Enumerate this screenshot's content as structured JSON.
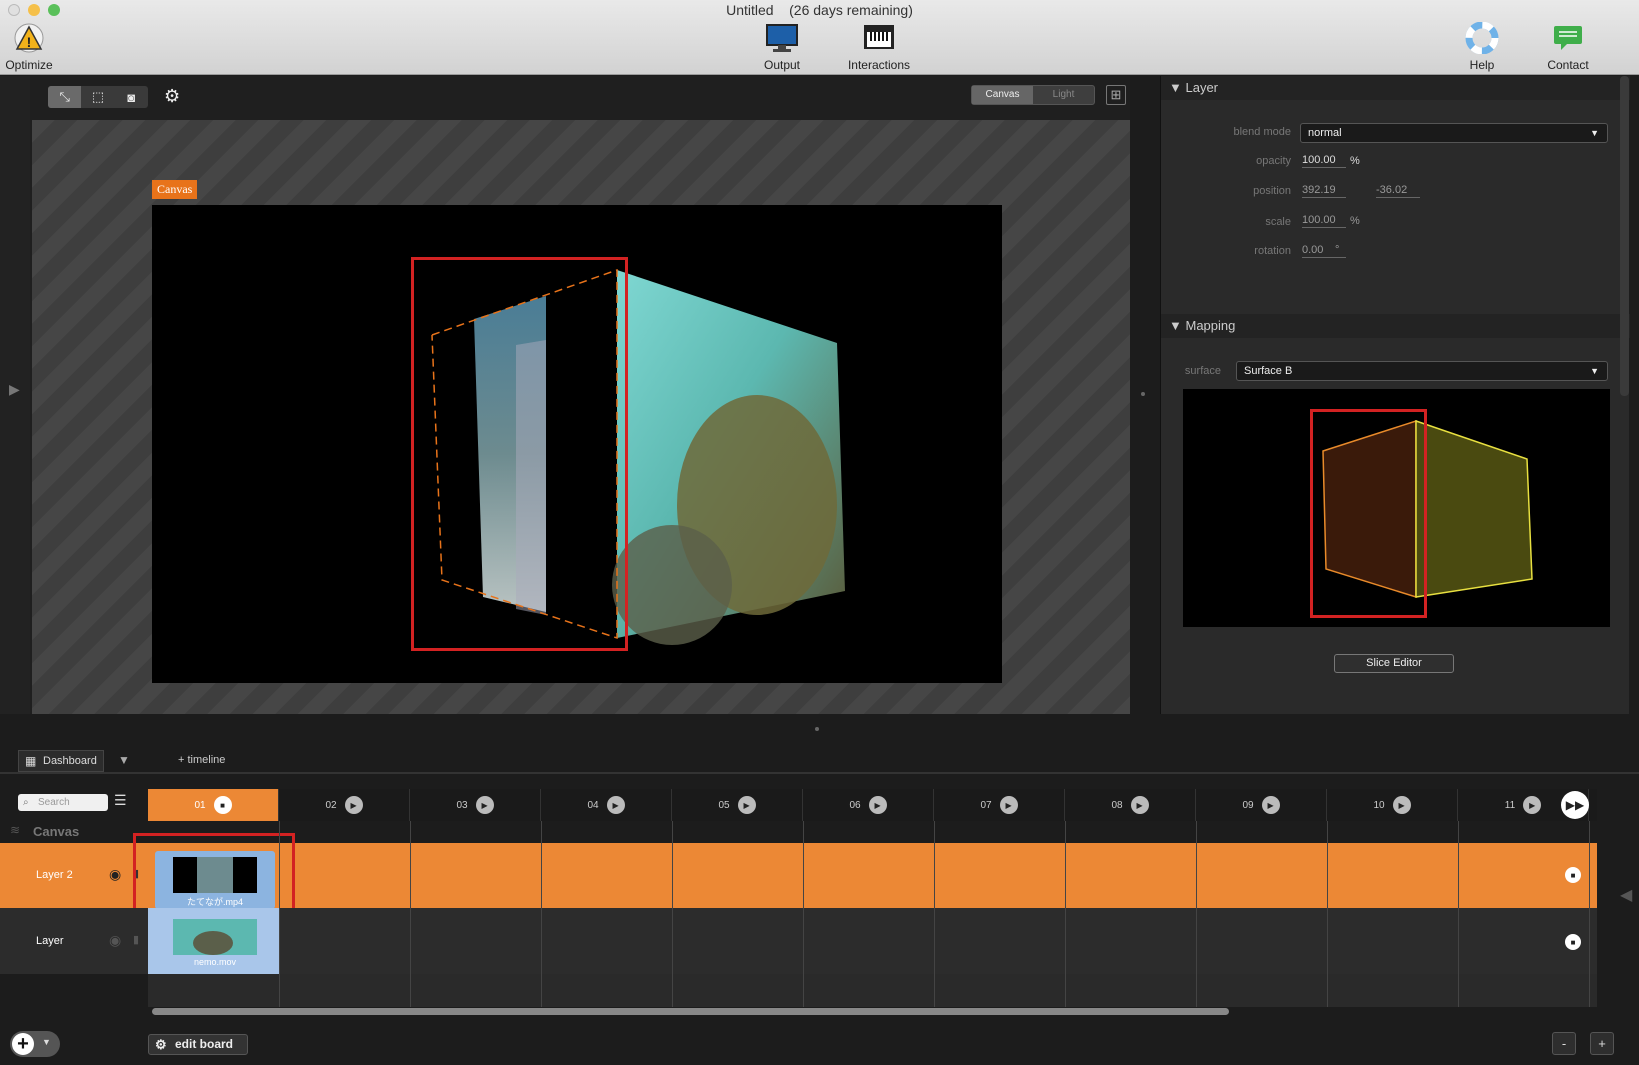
{
  "window": {
    "title": "Untitled",
    "trial": "(26 days remaining)"
  },
  "toolbar": {
    "optimize": "Optimize",
    "output": "Output",
    "interactions": "Interactions",
    "help": "Help",
    "contact": "Contact"
  },
  "view": {
    "seg_canvas": "Canvas",
    "seg_light": "Light",
    "canvas_tag": "Canvas"
  },
  "layer_panel": {
    "header": "Layer",
    "blend_mode_label": "blend mode",
    "blend_mode_value": "normal",
    "opacity_label": "opacity",
    "opacity_value": "100.00",
    "opacity_unit": "%",
    "position_label": "position",
    "position_x": "392.19",
    "position_y": "-36.02",
    "scale_label": "scale",
    "scale_value": "100.00",
    "scale_unit": "%",
    "rotation_label": "rotation",
    "rotation_value": "0.00",
    "rotation_unit": "°"
  },
  "mapping_panel": {
    "header": "Mapping",
    "surface_label": "surface",
    "surface_value": "Surface B",
    "slice_editor": "Slice Editor"
  },
  "dashboard": {
    "tab": "Dashboard",
    "add_timeline": "+ timeline",
    "search_placeholder": "Search",
    "canvas_label": "Canvas",
    "cues": [
      "01",
      "02",
      "03",
      "04",
      "05",
      "06",
      "07",
      "08",
      "09",
      "10",
      "11"
    ],
    "layers": [
      {
        "name": "Layer 2",
        "clip": "たてなが.mp4",
        "selected": true
      },
      {
        "name": "Layer",
        "clip": "nemo.mov",
        "selected": false
      }
    ],
    "edit_board": "edit board",
    "zoom_out": "-",
    "zoom_in": "+"
  },
  "colors": {
    "accent": "#e8731a",
    "clip": "#8cb4e0",
    "highlight": "#d32222"
  }
}
